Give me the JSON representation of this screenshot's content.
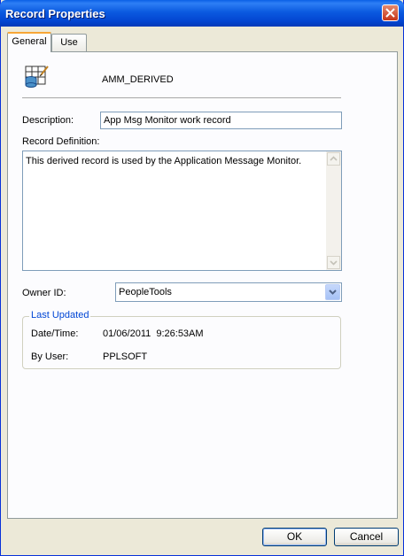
{
  "window": {
    "title": "Record Properties"
  },
  "tabs": [
    {
      "label": "General"
    },
    {
      "label": "Use"
    }
  ],
  "record": {
    "name": "AMM_DERIVED",
    "icon": "record-table-icon"
  },
  "description": {
    "label": "Description:",
    "value": "App Msg Monitor work record"
  },
  "definition": {
    "label": "Record Definition:",
    "value": "This derived record is used by the Application  Message Monitor."
  },
  "owner": {
    "label": "Owner ID:",
    "value": "PeopleTools"
  },
  "last_updated": {
    "legend": "Last Updated",
    "datetime_label": "Date/Time:",
    "datetime_value": "01/06/2011  9:26:53AM",
    "user_label": "By User:",
    "user_value": "PPLSOFT"
  },
  "buttons": {
    "ok": "OK",
    "cancel": "Cancel"
  },
  "colors": {
    "titlebar": "#0a5fe6",
    "legend": "#0046d5",
    "tab_highlight": "#f7a636"
  }
}
